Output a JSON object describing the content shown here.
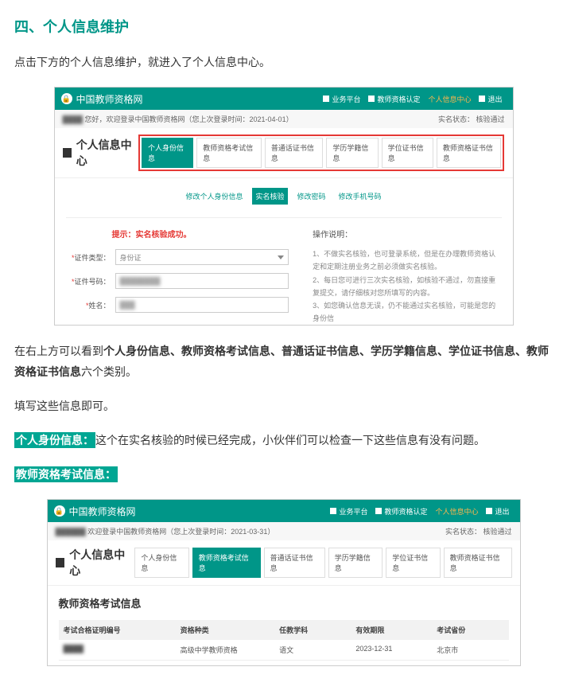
{
  "doc": {
    "heading": "四、个人信息维护",
    "p1": "点击下方的个人信息维护，就进入了个人信息中心。",
    "p2_a": "在右上方可以看到",
    "p2_b": "个人身份信息、教师资格考试信息、普通话证书信息、学历学籍信息、学位证书信息、教师资格证书信息",
    "p2_c": "六个类别。",
    "p3": "填写这些信息即可。",
    "p4_hl": "个人身份信息：",
    "p4_rest": "这个在实名核验的时候已经完成，小伙伴们可以检查一下这些信息有没有问题。",
    "p5_hl": "教师资格考试信息："
  },
  "shot1": {
    "site": "中国教师资格网",
    "nav": {
      "biz": "业务平台",
      "cert": "教师资格认定",
      "personal": "个人信息中心",
      "logout": "退出"
    },
    "greet_blur": "████",
    "greet": "您好，欢迎登录中国教师资格网（您上次登录时间：2021-04-01）",
    "status_lbl": "实名状态：",
    "status_val": "核验通过",
    "center_title": "个人信息中心",
    "tabs": [
      "个人身份信息",
      "教师资格考试信息",
      "普通话证书信息",
      "学历学籍信息",
      "学位证书信息",
      "教师资格证书信息"
    ],
    "subtabs": [
      "修改个人身份信息",
      "实名核验",
      "修改密码",
      "修改手机号码"
    ],
    "hint": "提示：实名核验成功。",
    "form": {
      "type_label": "证件类型：",
      "type_value": "身份证",
      "num_label": "证件号码：",
      "name_label": "姓名："
    },
    "ops": {
      "title": "操作说明：",
      "i1": "1、不做实名核验，也可登录系统，但是在办理教师资格认定和定期注册业务之前必须做实名核验。",
      "i2": "2、每日您可进行三次实名核验，如核验不通过，勿直接重复提交，请仔细核对您所填写的内容。",
      "i3": "3、如您确认信息无误，仍不能通过实名核验，可能是您的身份信"
    }
  },
  "shot2": {
    "site": "中国教师资格网",
    "nav": {
      "biz": "业务平台",
      "cert": "教师资格认定",
      "personal": "个人信息中心",
      "logout": "退出"
    },
    "greet_blur": "██████",
    "greet": " 欢迎登录中国教师资格网（您上次登录时间：2021-03-31）",
    "status_lbl": "实名状态：",
    "status_val": "核验通过",
    "center_title": "个人信息中心",
    "tabs": [
      "个人身份信息",
      "教师资格考试信息",
      "普通话证书信息",
      "学历学籍信息",
      "学位证书信息",
      "教师资格证书信息"
    ],
    "exam_title": "教师资格考试信息",
    "columns": [
      "考试合格证明编号",
      "资格种类",
      "任教学科",
      "有效期限",
      "考试省份"
    ],
    "row": {
      "num": "████",
      "kind": "高级中学教师资格",
      "subject": "语文",
      "expire": "2023-12-31",
      "province": "北京市"
    }
  }
}
